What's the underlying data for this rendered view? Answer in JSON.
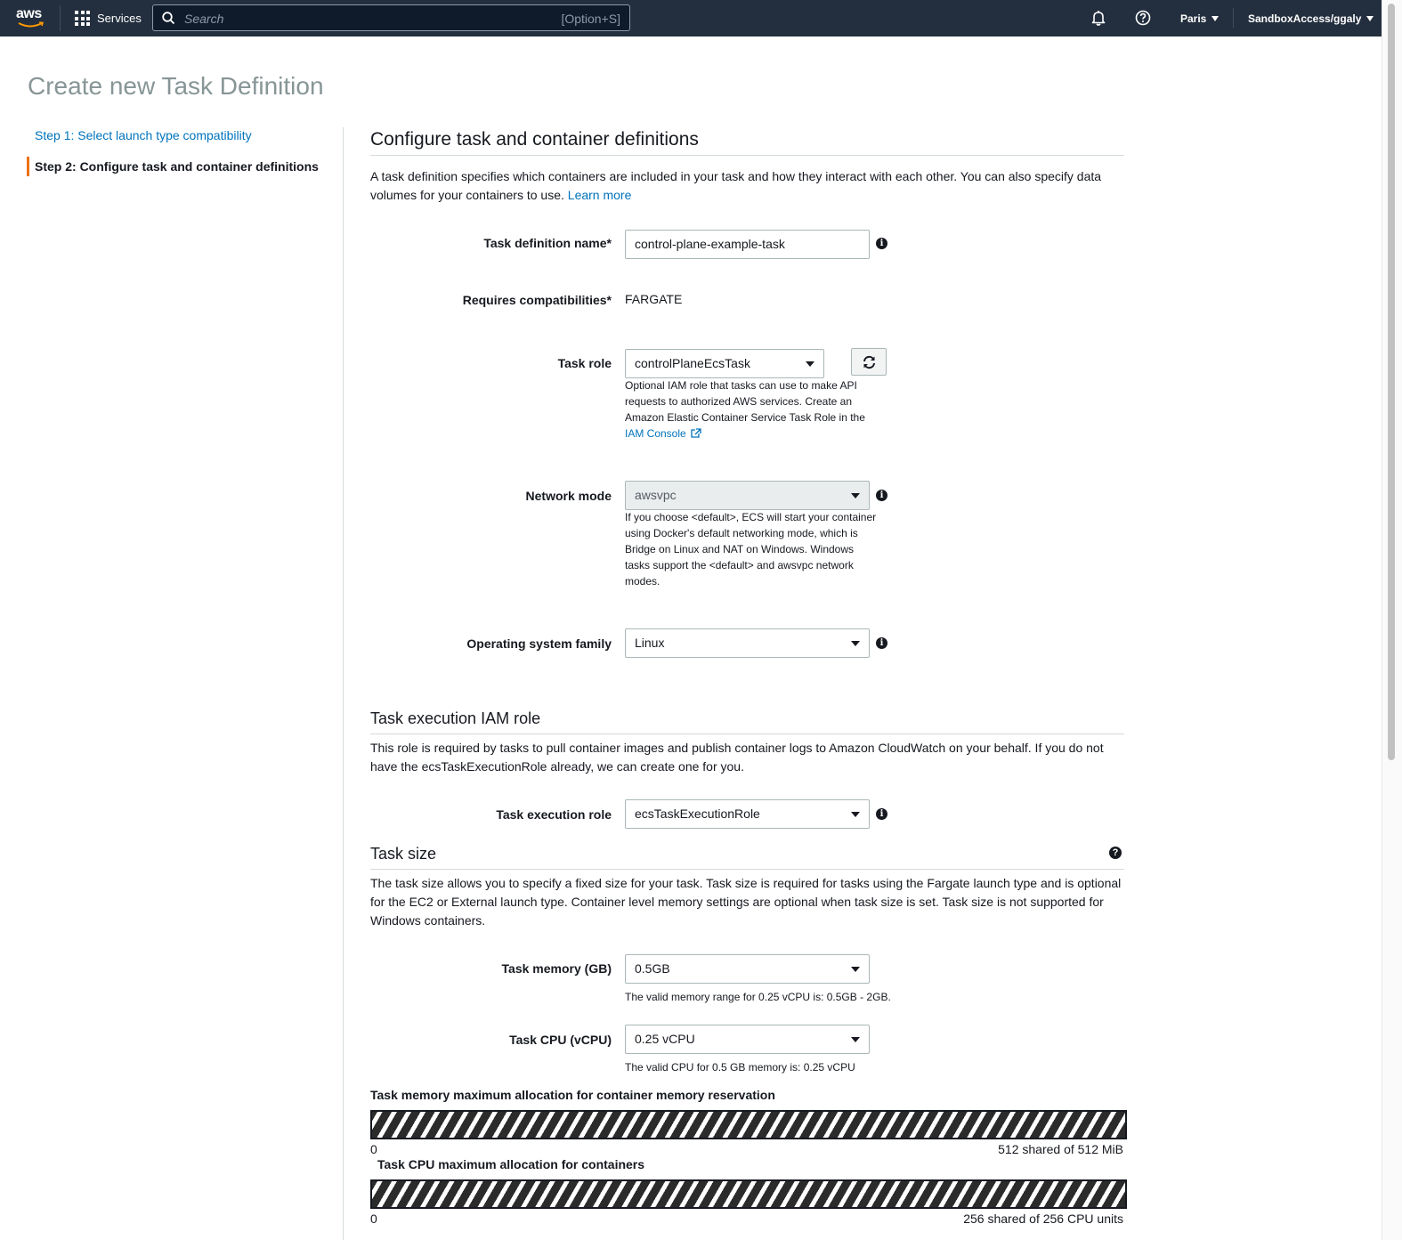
{
  "nav": {
    "logo_text": "aws",
    "services_label": "Services",
    "search_placeholder": "Search",
    "search_shortcut": "[Option+S]",
    "region": "Paris",
    "account": "SandboxAccess/ggaly"
  },
  "page": {
    "title": "Create new Task Definition"
  },
  "steps": [
    {
      "label": "Step 1: Select launch type compatibility",
      "active": false
    },
    {
      "label": "Step 2: Configure task and container definitions",
      "active": true
    }
  ],
  "configure": {
    "title": "Configure task and container definitions",
    "description": "A task definition specifies which containers are included in your task and how they interact with each other. You can also specify data volumes for your containers to use.",
    "learn_more": "Learn more",
    "task_definition_name_label": "Task definition name*",
    "task_definition_name_value": "control-plane-example-task",
    "requires_compat_label": "Requires compatibilities*",
    "requires_compat_value": "FARGATE",
    "task_role_label": "Task role",
    "task_role_value": "controlPlaneEcsTask",
    "task_role_help": "Optional IAM role that tasks can use to make API requests to authorized AWS services. Create an Amazon Elastic Container Service Task Role in the",
    "task_role_link": "IAM Console",
    "network_mode_label": "Network mode",
    "network_mode_value": "awsvpc",
    "network_mode_help": "If you choose <default>, ECS will start your container using Docker's default networking mode, which is Bridge on Linux and NAT on Windows. Windows tasks support the <default> and awsvpc network modes.",
    "os_family_label": "Operating system family",
    "os_family_value": "Linux"
  },
  "execution": {
    "title": "Task execution IAM role",
    "description": "This role is required by tasks to pull container images and publish container logs to Amazon CloudWatch on your behalf. If you do not have the ecsTaskExecutionRole already, we can create one for you.",
    "role_label": "Task execution role",
    "role_value": "ecsTaskExecutionRole"
  },
  "task_size": {
    "title": "Task size",
    "description": "The task size allows you to specify a fixed size for your task. Task size is required for tasks using the Fargate launch type and is optional for the EC2 or External launch type. Container level memory settings are optional when task size is set. Task size is not supported for Windows containers.",
    "memory_label": "Task memory (GB)",
    "memory_value": "0.5GB",
    "memory_help": "The valid memory range for 0.25 vCPU is: 0.5GB - 2GB.",
    "cpu_label": "Task CPU (vCPU)",
    "cpu_value": "0.25 vCPU",
    "cpu_help": "The valid CPU for 0.5 GB memory is: 0.25 vCPU",
    "memory_bar_label": "Task memory maximum allocation for container memory reservation",
    "memory_bar_min": "0",
    "memory_bar_max": "512 shared of 512 MiB",
    "memory_bar_fraction": 1.0,
    "cpu_bar_label": "Task CPU maximum allocation for containers",
    "cpu_bar_min": "0",
    "cpu_bar_max": "256 shared of 256 CPU units",
    "cpu_bar_fraction": 1.0
  }
}
